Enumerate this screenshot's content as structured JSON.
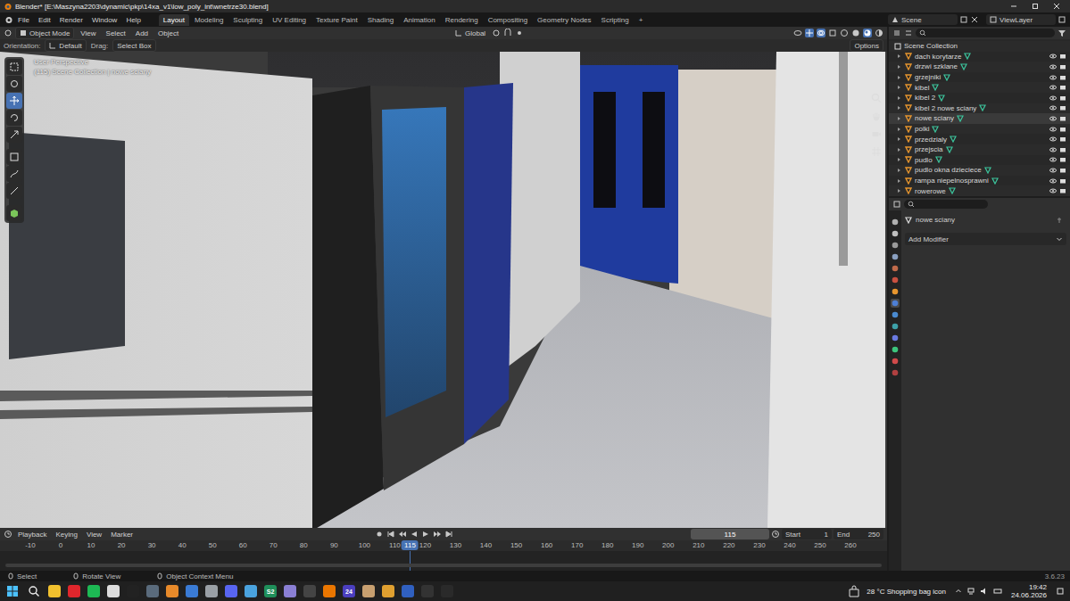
{
  "window": {
    "title": "Blender* [E:\\Maszyna2203\\dynamic\\pkp\\14xa_v1\\low_poly_int\\wnetrze30.blend]"
  },
  "menu": [
    "File",
    "Edit",
    "Render",
    "Window",
    "Help"
  ],
  "workspaces": [
    {
      "label": "Layout",
      "selected": true
    },
    {
      "label": "Modeling",
      "selected": false
    },
    {
      "label": "Sculpting",
      "selected": false
    },
    {
      "label": "UV Editing",
      "selected": false
    },
    {
      "label": "Texture Paint",
      "selected": false
    },
    {
      "label": "Shading",
      "selected": false
    },
    {
      "label": "Animation",
      "selected": false
    },
    {
      "label": "Rendering",
      "selected": false
    },
    {
      "label": "Compositing",
      "selected": false
    },
    {
      "label": "Geometry Nodes",
      "selected": false
    },
    {
      "label": "Scripting",
      "selected": false
    }
  ],
  "add_workspace": "+",
  "scene": "Scene",
  "view_layer": "ViewLayer",
  "viewport": {
    "mode": "Object Mode",
    "menu": [
      "View",
      "Select",
      "Add",
      "Object"
    ],
    "transform": "Global",
    "tool_settings": {
      "orientation_label": "Orientation:",
      "orientation": "Default",
      "drag_label": "Drag:",
      "drag": "Select Box",
      "options": "Options"
    },
    "overlay": [
      "User Perspective",
      "(115) Scene Collection | nowe sciany"
    ]
  },
  "outliner": {
    "root": "Scene Collection",
    "items": [
      {
        "name": "dach korytarze",
        "selected": false
      },
      {
        "name": "drzwi szklane",
        "selected": false
      },
      {
        "name": "grzejniki",
        "selected": false
      },
      {
        "name": "kibel",
        "selected": false
      },
      {
        "name": "kibel 2",
        "selected": false
      },
      {
        "name": "kibel 2 nowe sciany",
        "selected": false
      },
      {
        "name": "nowe sciany",
        "selected": true
      },
      {
        "name": "polki",
        "selected": false
      },
      {
        "name": "przedzialy",
        "selected": false
      },
      {
        "name": "przejscia",
        "selected": false
      },
      {
        "name": "pudlo",
        "selected": false
      },
      {
        "name": "pudlo okna dzieciece",
        "selected": false
      },
      {
        "name": "rampa niepelnosprawni",
        "selected": false
      },
      {
        "name": "rowerowe",
        "selected": false
      }
    ]
  },
  "properties": {
    "object": "nowe sciany",
    "add_modifier": "Add Modifier"
  },
  "timeline": {
    "menu": [
      "Playback",
      "Keying",
      "View",
      "Marker"
    ],
    "current_frame": "115",
    "start_label": "Start",
    "start": "1",
    "end_label": "End",
    "end": "250",
    "ruler": [
      "-10",
      "0",
      "10",
      "20",
      "30",
      "40",
      "50",
      "60",
      "70",
      "80",
      "90",
      "100",
      "110",
      "120",
      "130",
      "140",
      "150",
      "160",
      "170",
      "180",
      "190",
      "200",
      "210",
      "220",
      "230",
      "240",
      "250",
      "260"
    ],
    "playhead": "115"
  },
  "status_bar": {
    "hints": [
      "Select",
      "Rotate View",
      "Object Context Menu"
    ],
    "version": "3.6.23"
  },
  "taskbar": {
    "apps": [
      {
        "glyph": "",
        "color": "#f2c12e"
      },
      {
        "glyph": "",
        "color": "#e0262c"
      },
      {
        "glyph": "",
        "color": "#1db954"
      },
      {
        "glyph": "",
        "color": "#dddddd"
      },
      {
        "glyph": "",
        "color": "#222222"
      },
      {
        "glyph": "",
        "color": "#5a6b7c"
      },
      {
        "glyph": "",
        "color": "#e88a2a"
      },
      {
        "glyph": "",
        "color": "#3a7bd5"
      },
      {
        "glyph": "",
        "color": "#9aa0a6"
      },
      {
        "glyph": "",
        "color": "#5865f2"
      },
      {
        "glyph": "",
        "color": "#4aa3df"
      },
      {
        "glyph": "S2",
        "color": "#1f8f5a"
      },
      {
        "glyph": "",
        "color": "#8a7fd4"
      },
      {
        "glyph": "",
        "color": "#444444"
      },
      {
        "glyph": "",
        "color": "#ea7600"
      },
      {
        "glyph": "24",
        "color": "#4b3fbf"
      },
      {
        "glyph": "",
        "color": "#c8a070"
      },
      {
        "glyph": "",
        "color": "#e0a030"
      },
      {
        "glyph": "",
        "color": "#3060c0"
      },
      {
        "glyph": "",
        "color": "#333333"
      },
      {
        "glyph": "",
        "color": "#2a2a2a"
      }
    ],
    "weather": "28 °C",
    "weather_text": "Shopping bag icon",
    "time": "19:42",
    "date": "24.06.2026"
  }
}
